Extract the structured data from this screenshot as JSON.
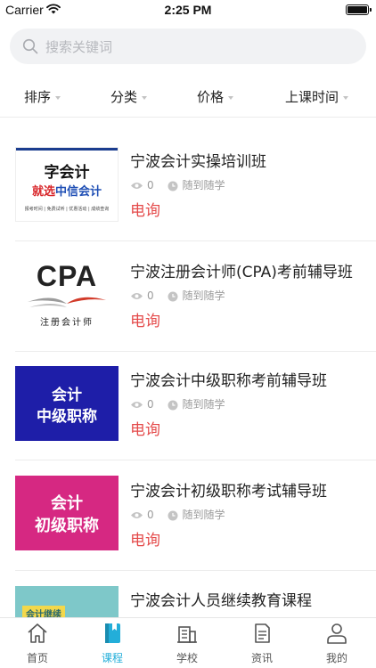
{
  "status_bar": {
    "carrier": "Carrier",
    "time": "2:25 PM"
  },
  "search": {
    "placeholder": "搜索关键词"
  },
  "filters": [
    {
      "label": "排序"
    },
    {
      "label": "分类"
    },
    {
      "label": "价格"
    },
    {
      "label": "上课时间"
    }
  ],
  "courses": [
    {
      "title": "宁波会计实操培训班",
      "views": "0",
      "schedule": "随到随学",
      "price": "电询",
      "thumb_text": [
        "字会计",
        "就选",
        "中信会计",
        "报考时间 | 免费试听 | 优惠活动 | 成绩查询"
      ]
    },
    {
      "title": "宁波注册会计师(CPA)考前辅导班",
      "views": "0",
      "schedule": "随到随学",
      "price": "电询",
      "thumb_text": [
        "CPA",
        "注册会计师"
      ]
    },
    {
      "title": "宁波会计中级职称考前辅导班",
      "views": "0",
      "schedule": "随到随学",
      "price": "电询",
      "thumb_text": [
        "会计",
        "中级职称"
      ]
    },
    {
      "title": "宁波会计初级职称考试辅导班",
      "views": "0",
      "schedule": "随到随学",
      "price": "电询",
      "thumb_text": [
        "会计",
        "初级职称"
      ]
    },
    {
      "title": "宁波会计人员继续教育课程",
      "views": "",
      "schedule": "",
      "price": "",
      "thumb_text": [
        "会计继续"
      ]
    }
  ],
  "tabs": [
    {
      "label": "首页",
      "icon": "home-icon"
    },
    {
      "label": "课程",
      "icon": "book-icon",
      "active": true
    },
    {
      "label": "学校",
      "icon": "building-icon"
    },
    {
      "label": "资讯",
      "icon": "document-icon"
    },
    {
      "label": "我的",
      "icon": "person-icon"
    }
  ],
  "colors": {
    "accent": "#23aed9",
    "price": "#e44a4a"
  }
}
